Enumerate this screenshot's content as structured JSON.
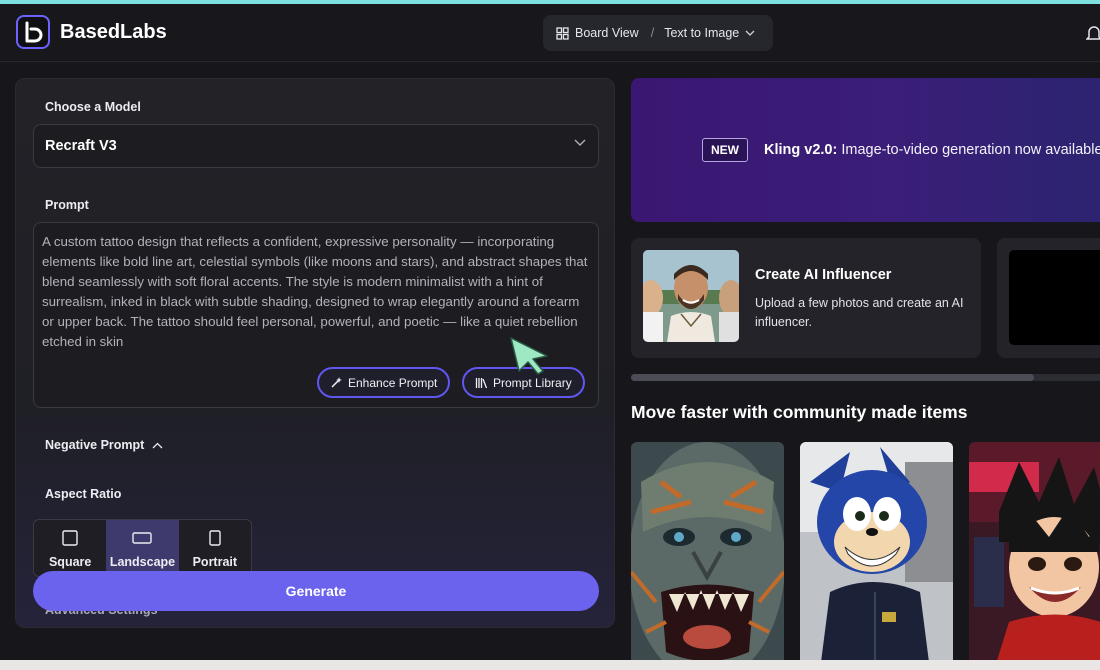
{
  "app": {
    "name": "BasedLabs"
  },
  "header": {
    "view_label": "Board View",
    "separator": "/",
    "mode_label": "Text to Image"
  },
  "model": {
    "label": "Choose a Model",
    "value": "Recraft V3"
  },
  "prompt": {
    "label": "Prompt",
    "value": "A custom tattoo design that reflects a confident, expressive personality — incorporating elements like bold line art, celestial symbols (like moons and stars), and abstract shapes that blend seamlessly with soft floral accents. The style is modern minimalist with a hint of surrealism, inked in black with subtle shading, designed to wrap elegantly around a forearm or upper back. The tattoo should feel personal, powerful, and poetic — like a quiet rebellion etched in skin",
    "enhance_label": "Enhance Prompt",
    "library_label": "Prompt Library"
  },
  "negative_prompt": {
    "label": "Negative Prompt"
  },
  "aspect_ratio": {
    "label": "Aspect Ratio",
    "options": [
      "Square",
      "Landscape",
      "Portrait"
    ],
    "selected": "Landscape"
  },
  "advanced": {
    "label": "Advanced Settings"
  },
  "generate": {
    "label": "Generate"
  },
  "banner": {
    "badge": "NEW",
    "title": "Kling v2.0:",
    "text": " Image-to-video generation now available"
  },
  "influencer_card": {
    "title": "Create AI Influencer",
    "description": "Upload a few photos and create an AI influencer."
  },
  "community": {
    "title": "Move faster with community made items"
  },
  "colors": {
    "accent": "#6b62ee",
    "background": "#17171b",
    "panel": "#222227",
    "banner": "#3a1772"
  }
}
